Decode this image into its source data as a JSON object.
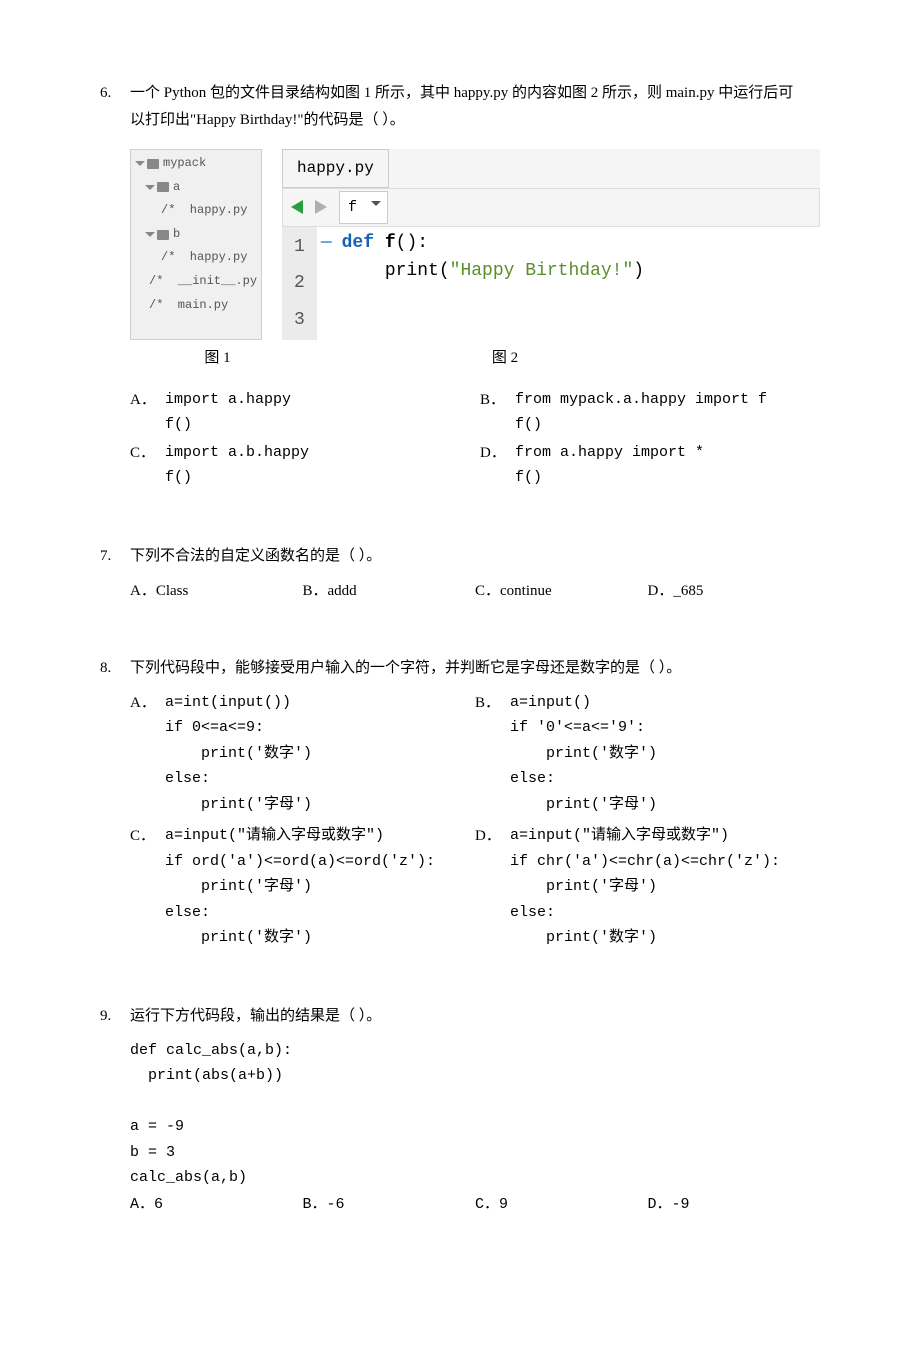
{
  "q6": {
    "number": "6.",
    "text_line1": "一个 Python 包的文件目录结构如图 1 所示，其中 happy.py 的内容如图 2 所示，则 main.py 中运行后可",
    "text_line2": "以打印出\"Happy Birthday!\"的代码是（    ）。",
    "tree": {
      "root": "mypack",
      "folder_a": "a",
      "file_a_happy": "/*  happy.py",
      "folder_b": "b",
      "file_b_happy": "/*  happy.py",
      "file_init": "/*  __init__.py",
      "file_main": "/*  main.py"
    },
    "editor": {
      "tab": "happy.py",
      "dropdown": "f",
      "line1": "1",
      "line2": "2",
      "line3": "3",
      "code_def": "def",
      "code_fn": "f",
      "code_paren": "():",
      "code_indent": "    print(",
      "code_str": "\"Happy Birthday!\"",
      "code_close": ")"
    },
    "fig1_label": "图 1",
    "fig2_label": "图 2",
    "options": {
      "A": "import a.happy\nf()",
      "B": "from mypack.a.happy import f\nf()",
      "C": "import a.b.happy\nf()",
      "D": "from a.happy import *\nf()"
    }
  },
  "q7": {
    "number": "7.",
    "text": "下列不合法的自定义函数名的是（    ）。",
    "options": {
      "A": "A．Class",
      "B": "B．addd",
      "C": "C．continue",
      "D": "D．_685"
    }
  },
  "q8": {
    "number": "8.",
    "text": "下列代码段中，能够接受用户输入的一个字符，并判断它是字母还是数字的是（    ）。",
    "options": {
      "A": "a=int(input())\nif 0<=a<=9:\n    print('数字')\nelse:\n    print('字母')",
      "B": "a=input()\nif '0'<=a<='9':\n    print('数字')\nelse:\n    print('字母')",
      "C": "a=input(\"请输入字母或数字\")\nif ord('a')<=ord(a)<=ord('z'):\n    print('字母')\nelse:\n    print('数字')",
      "D": "a=input(\"请输入字母或数字\")\nif chr('a')<=chr(a)<=chr('z'):\n    print('字母')\nelse:\n    print('数字')"
    }
  },
  "q9": {
    "number": "9.",
    "text": "运行下方代码段，输出的结果是（    ）。",
    "code": "def calc_abs(a,b):\n  print(abs(a+b))\n\na = -9\nb = 3\ncalc_abs(a,b)",
    "options": {
      "A": "A．6",
      "B": "B．-6",
      "C": "C．9",
      "D": "D．-9"
    }
  }
}
